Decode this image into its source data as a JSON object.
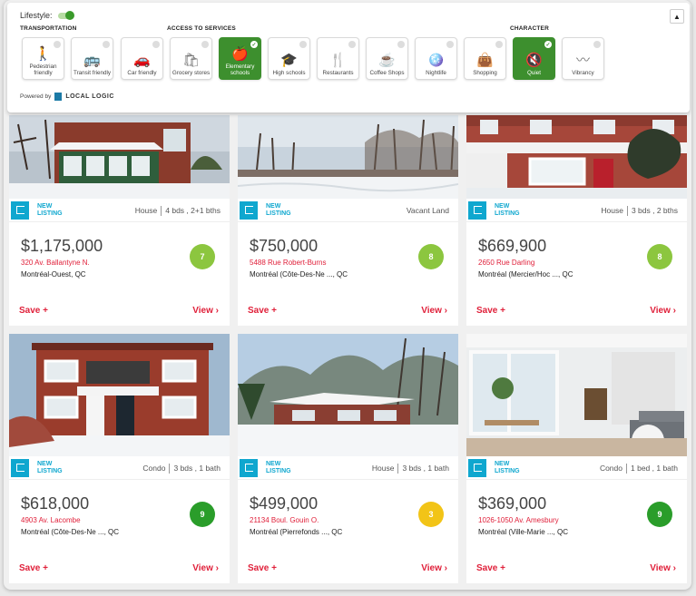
{
  "panel": {
    "lifestyle_label": "Lifestyle:",
    "collapse_icon": "▲",
    "sections": {
      "transportation": "TRANSPORTATION",
      "services": "ACCESS TO SERVICES",
      "character": "CHARACTER"
    },
    "chips": [
      {
        "label": "Pedestrian friendly",
        "icon": "walk-icon",
        "glyph": "🚶",
        "selected": false
      },
      {
        "label": "Transit friendly",
        "icon": "bus-icon",
        "glyph": "🚌",
        "selected": false
      },
      {
        "label": "Car friendly",
        "icon": "car-icon",
        "glyph": "🚗",
        "selected": false
      },
      {
        "label": "Grocery stores",
        "icon": "grocery-bag-icon",
        "glyph": "🛍",
        "selected": false
      },
      {
        "label": "Elementary schools",
        "icon": "apple-icon",
        "glyph": "🍎",
        "selected": true
      },
      {
        "label": "High schools",
        "icon": "graduation-cap-icon",
        "glyph": "🎓",
        "selected": false
      },
      {
        "label": "Restaurants",
        "icon": "cutlery-icon",
        "glyph": "🍴",
        "selected": false
      },
      {
        "label": "Coffee Shops",
        "icon": "coffee-cup-icon",
        "glyph": "☕",
        "selected": false
      },
      {
        "label": "Nightlife",
        "icon": "disco-ball-icon",
        "glyph": "🪩",
        "selected": false
      },
      {
        "label": "Shopping",
        "icon": "shopping-bag-icon",
        "glyph": "👜",
        "selected": false
      },
      {
        "label": "Quiet",
        "icon": "mute-speaker-icon",
        "glyph": "🔇",
        "selected": true
      },
      {
        "label": "Vibrancy",
        "icon": "pulse-wave-icon",
        "glyph": "〰",
        "selected": false
      }
    ],
    "powered_by": "Powered by",
    "brand": "LOCAL LOGIC"
  },
  "listings": [
    {
      "new_label_1": "NEW",
      "new_label_2": "LISTING",
      "type": "House",
      "details": "4 bds , 2+1 bths",
      "price": "$1,175,000",
      "address": "320 Av. Ballantyne N.",
      "city": "Montréal-Ouest, QC",
      "score": "7",
      "score_color": "#8cc63f",
      "save": "Save",
      "view": "View"
    },
    {
      "new_label_1": "NEW",
      "new_label_2": "LISTING",
      "type": "Vacant Land",
      "details": "",
      "price": "$750,000",
      "address": "5488 Rue Robert-Burns",
      "city": "Montréal (Côte-Des-Ne ..., QC",
      "score": "8",
      "score_color": "#8cc63f",
      "save": "Save",
      "view": "View"
    },
    {
      "new_label_1": "NEW",
      "new_label_2": "LISTING",
      "type": "House",
      "details": "3 bds , 2 bths",
      "price": "$669,900",
      "address": "2650 Rue Darling",
      "city": "Montréal (Mercier/Hoc ..., QC",
      "score": "8",
      "score_color": "#8cc63f",
      "save": "Save",
      "view": "View"
    },
    {
      "new_label_1": "NEW",
      "new_label_2": "LISTING",
      "type": "Condo",
      "details": "3 bds , 1 bath",
      "price": "$618,000",
      "address": "4903 Av. Lacombe",
      "city": "Montréal (Côte-Des-Ne ..., QC",
      "score": "9",
      "score_color": "#2a9d2a",
      "save": "Save",
      "view": "View"
    },
    {
      "new_label_1": "NEW",
      "new_label_2": "LISTING",
      "type": "House",
      "details": "3 bds , 1 bath",
      "price": "$499,000",
      "address": "21134 Boul. Gouin O.",
      "city": "Montréal (Pierrefonds ..., QC",
      "score": "3",
      "score_color": "#f2c417",
      "save": "Save",
      "view": "View"
    },
    {
      "new_label_1": "NEW",
      "new_label_2": "LISTING",
      "type": "Condo",
      "details": "1 bed , 1 bath",
      "price": "$369,000",
      "address": "1026-1050 Av. Amesbury",
      "city": "Montréal (Ville-Marie ..., QC",
      "score": "9",
      "score_color": "#2a9d2a",
      "save": "Save",
      "view": "View"
    }
  ],
  "colors": {
    "accent_red": "#e0203a",
    "listing_blue": "#0fa7cf",
    "selected_green": "#3d8f2e"
  }
}
